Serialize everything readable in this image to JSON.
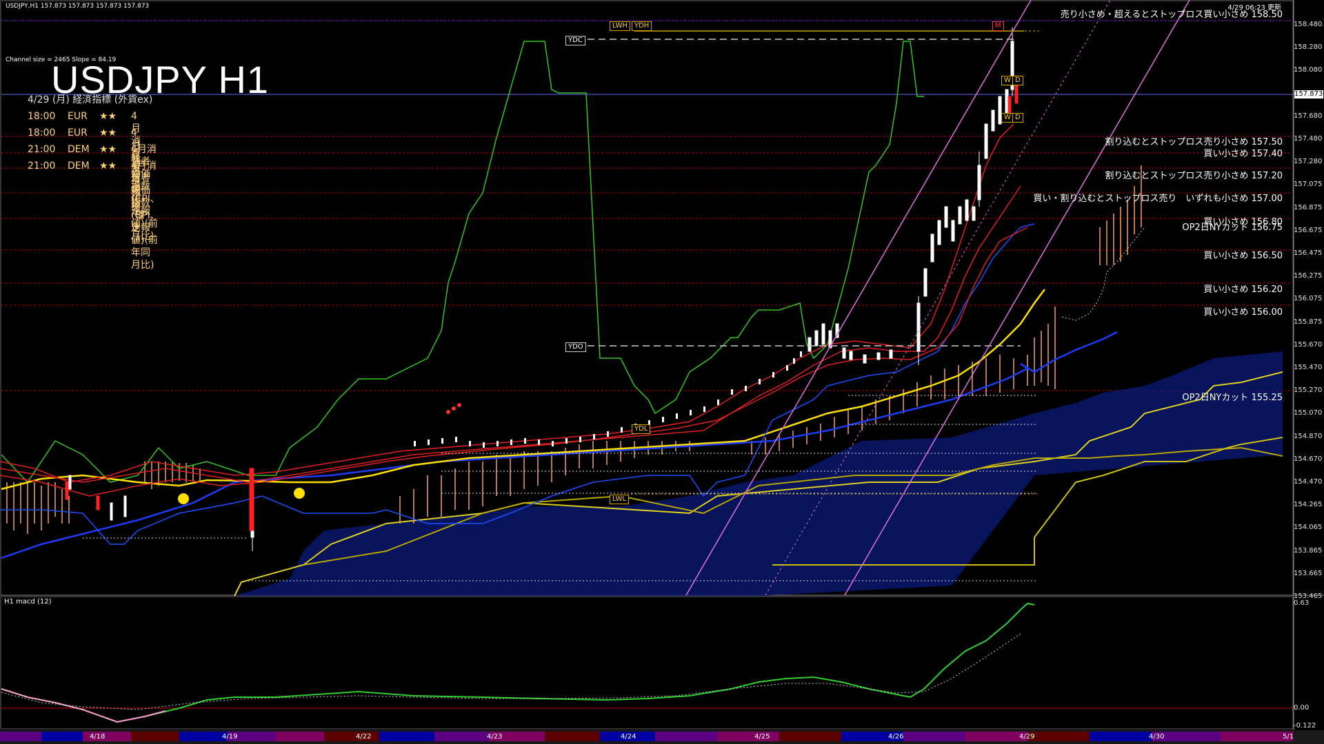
{
  "header": {
    "symbol_info": "USDJPY,H1  157.873 157.873 157.873 157.873",
    "update_time": "4/29 06:23 更新",
    "channel_info": "Channel size = 2465 Slope = 84.19",
    "title": "USDJPY H1"
  },
  "events": {
    "heading": "4/29 (月) 経済指標 (外貨ex)",
    "items": [
      {
        "time": "18:00",
        "cur": "EUR",
        "stars": "★★",
        "name": "4月消費者信頼感(確定値)"
      },
      {
        "time": "18:00",
        "cur": "EUR",
        "stars": "★★",
        "name": "4月経済信頼感"
      },
      {
        "time": "21:00",
        "cur": "DEM",
        "stars": "★★",
        "name": "4月消費者物価指数(CPI、速報値)(前月比)"
      },
      {
        "time": "21:00",
        "cur": "DEM",
        "stars": "★★",
        "name": "4月消費者物価指数(CPI、速報値)(前年同月比)"
      }
    ]
  },
  "notes": [
    "売り小さめ・超えるとストップロス買い小さめ 158.50",
    "割り込むとストップロス売り小さめ 157.50",
    "買い小さめ 157.40",
    "割り込むとストップロス売り小さめ 157.20",
    "買い・割り込むとストップロス売り　いずれも小さめ 157.00",
    "買い小さめ 156.80",
    "OP2日NYカット 156.75",
    "買い小さめ 156.50",
    "買い小さめ 156.20",
    "買い小さめ 156.00",
    "OP2日NYカット 155.25"
  ],
  "tags": {
    "lwh": "LWH",
    "ydh": "YDH",
    "ydc": "YDC",
    "ydo": "YDO",
    "ydl": "YDL",
    "lwl": "LWL",
    "w": "W",
    "d": "D",
    "m": "M"
  },
  "price_axis": [
    "158.480",
    "158.280",
    "158.080",
    "157.873",
    "157.680",
    "157.480",
    "157.280",
    "157.075",
    "156.875",
    "156.675",
    "156.475",
    "156.275",
    "156.075",
    "155.875",
    "155.670",
    "155.470",
    "155.270",
    "155.070",
    "154.870",
    "154.670",
    "154.470",
    "154.265",
    "154.065",
    "153.865",
    "153.665",
    "153.465"
  ],
  "current_price": "157.873",
  "macd": {
    "label": "H1 macd (12)",
    "axis": [
      "0.63",
      "0.00",
      "-0.122"
    ]
  },
  "dates": [
    "4/18",
    "4/19",
    "4/22",
    "4/23",
    "4/24",
    "4/25",
    "4/26",
    "4/29",
    "4/30",
    "5/1"
  ],
  "colors": {
    "background": "#000000",
    "grid_red": "#c00000",
    "kumo": "#f4a261",
    "ma_blue": "#1e3cff",
    "ma_yellow": "#ffe000"
  }
}
